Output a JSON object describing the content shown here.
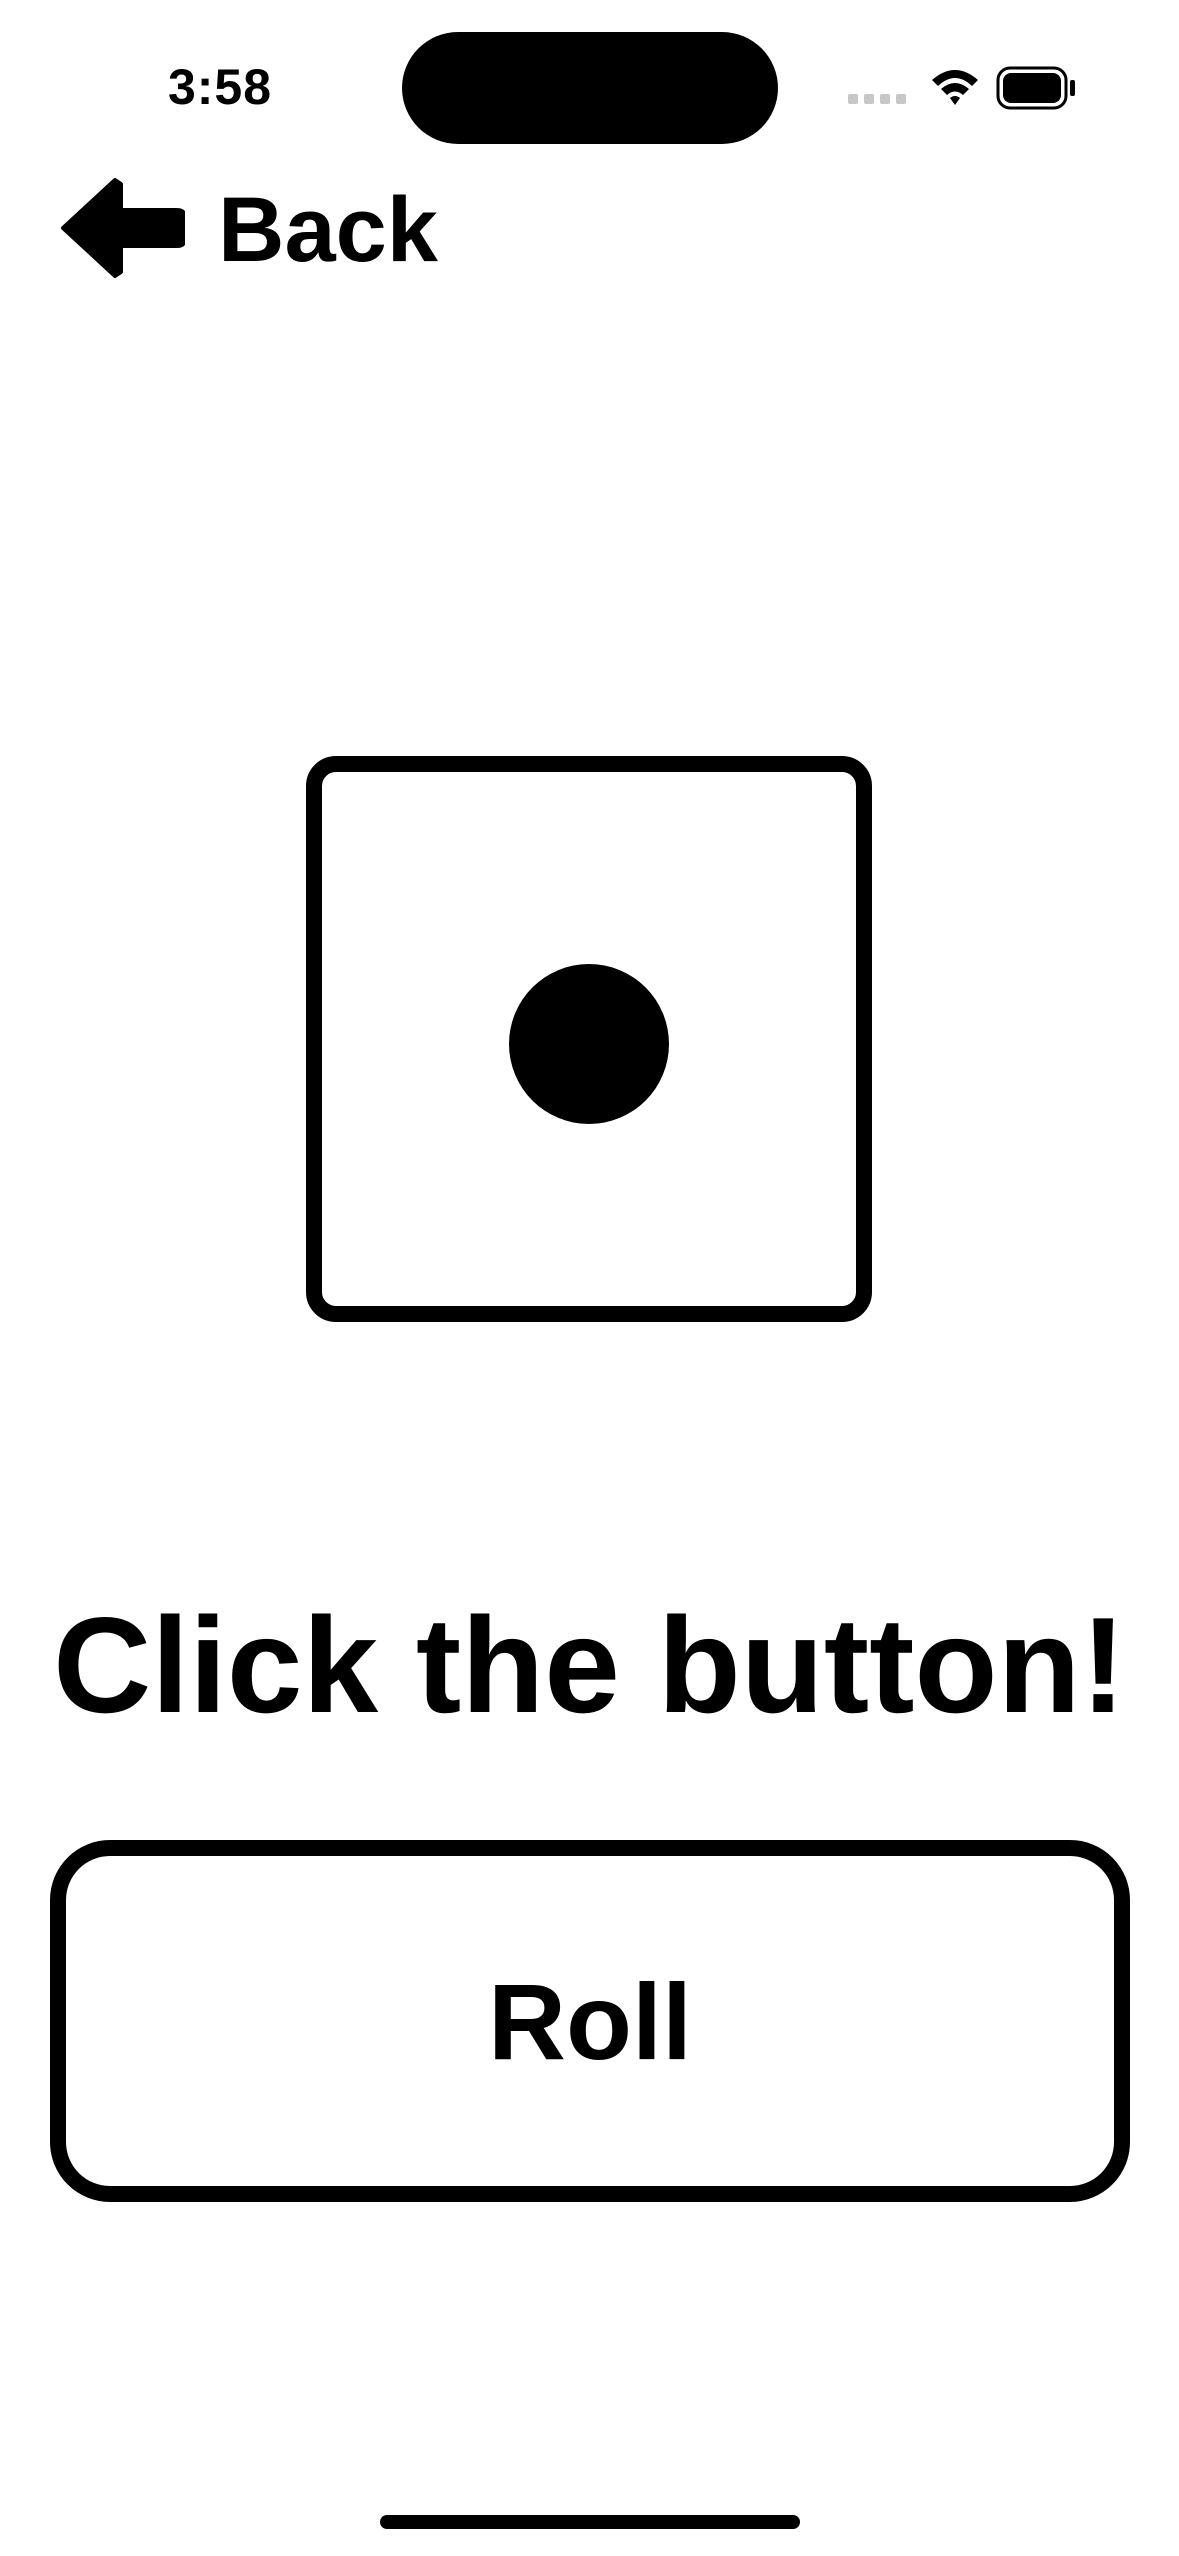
{
  "status_bar": {
    "time": "3:58",
    "signal_icon": "cellular-signal-dim-icon",
    "wifi_icon": "wifi-icon",
    "battery_icon": "battery-full-icon"
  },
  "nav": {
    "back_icon": "arrow-left-icon",
    "back_label": "Back"
  },
  "die": {
    "icon": "die-face-one-icon",
    "face_value": 1
  },
  "main": {
    "prompt": "Click the button!",
    "roll_label": "Roll"
  },
  "colors": {
    "foreground": "#000000",
    "background": "#ffffff",
    "signal_dim": "#c7c7c7"
  }
}
